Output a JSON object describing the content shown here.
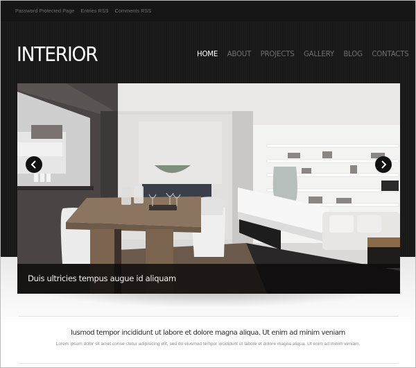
{
  "topbar": {
    "links": [
      "Password Protected Page",
      "Entries RSS",
      "Comments RSS"
    ]
  },
  "header": {
    "logo": "INTERIOR",
    "nav": [
      {
        "label": "HOME",
        "active": true
      },
      {
        "label": "ABOUT",
        "active": false
      },
      {
        "label": "PROJECTS",
        "active": false
      },
      {
        "label": "GALLERY",
        "active": false
      },
      {
        "label": "BLOG",
        "active": false
      },
      {
        "label": "CONTACTS",
        "active": false
      }
    ]
  },
  "slider": {
    "caption": "Duis ultricies tempus augue id aliquam",
    "prev_icon": "chevron-left-icon",
    "next_icon": "chevron-right-icon",
    "image_description": "Modern interior with rustic wooden dining table, white chairs, shelving and sofa"
  },
  "content": {
    "headline": "Iusmod tempor incididunt ut labore et dolore magna aliqua. Ut enim ad minim veniam",
    "body": "Lorem ipsum dolor sit amet conse ctetur adipisicing elit, sed do eiusmod tempor incididunt ut labore et dolore magna aliqua. Ut enim ad minim veniam."
  },
  "colors": {
    "header_bg": "#1a191a",
    "nav_active": "#ffffff",
    "nav_inactive": "#707070",
    "caption_bg": "#0c0a0a"
  }
}
